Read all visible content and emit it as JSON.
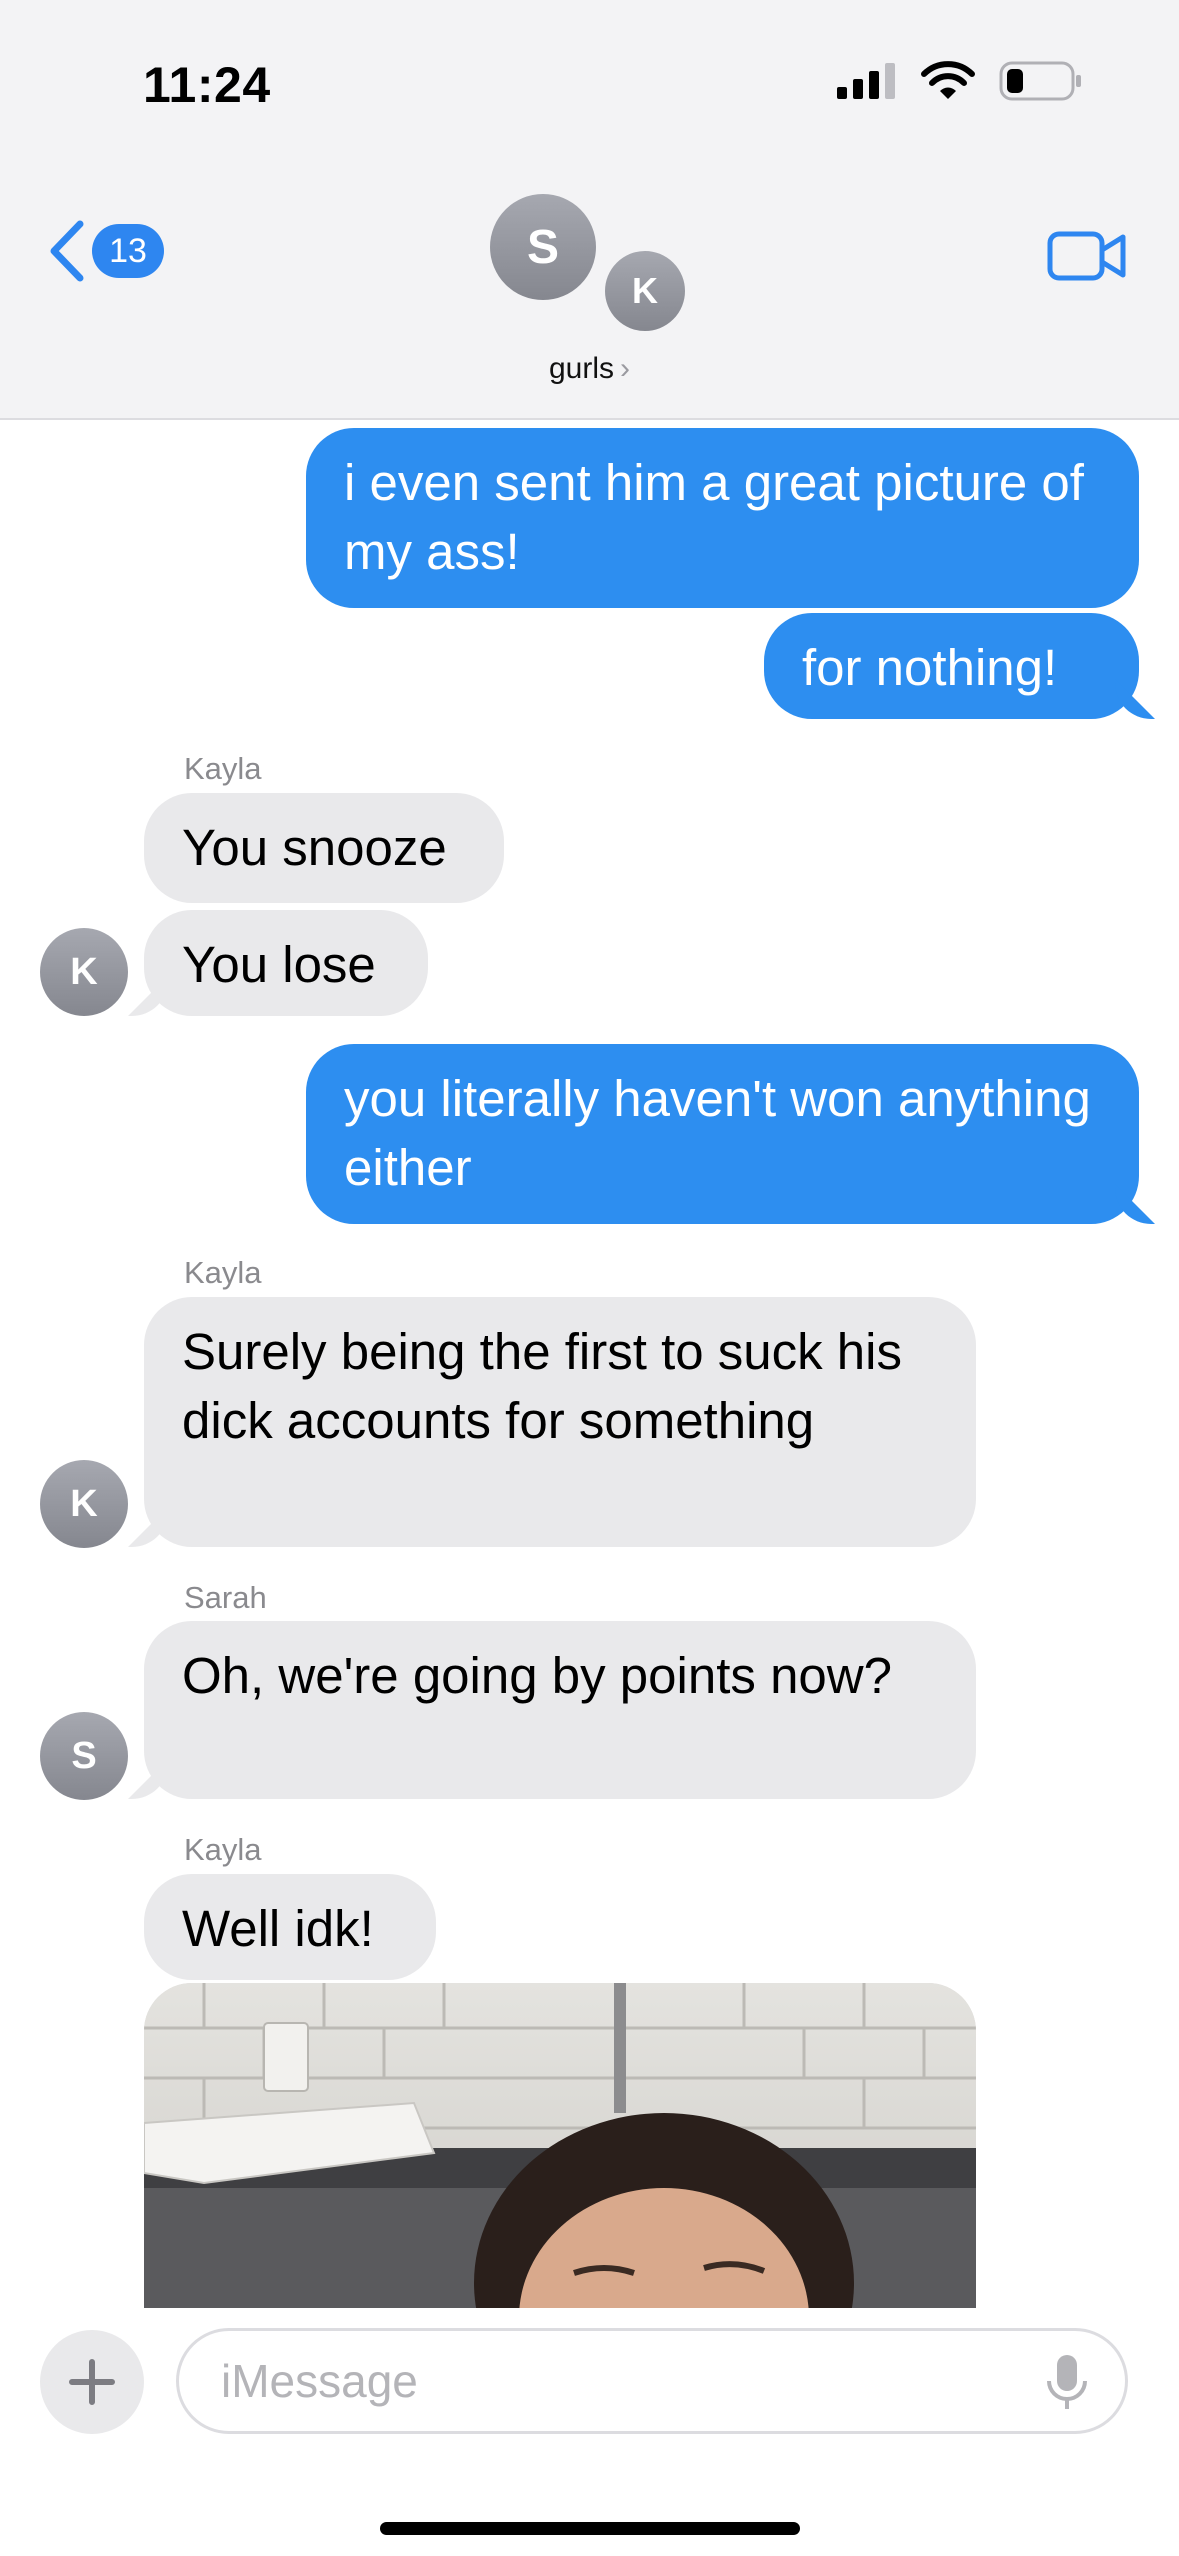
{
  "status_bar": {
    "time": "11:24"
  },
  "header": {
    "back_count": "13",
    "avatar_s": "S",
    "avatar_k": "K",
    "group_name": "gurls",
    "chevron": "›"
  },
  "messages": [
    {
      "from": "me",
      "text": "i even sent him a great picture of my ass!"
    },
    {
      "from": "me",
      "text": "for nothing!"
    },
    {
      "from": "Kayla",
      "sender_label": "Kayla",
      "text": "You snooze"
    },
    {
      "from": "Kayla",
      "text": "You lose",
      "avatar": "K"
    },
    {
      "from": "me",
      "text": "you literally haven't won anything either"
    },
    {
      "from": "Kayla",
      "sender_label": "Kayla",
      "text": "Surely being the first to suck his dick accounts for something",
      "avatar": "K"
    },
    {
      "from": "Sarah",
      "sender_label": "Sarah",
      "text": "Oh, we're going by points now?",
      "avatar": "S"
    },
    {
      "from": "Kayla",
      "sender_label": "Kayla",
      "text": "Well idk!"
    }
  ],
  "input": {
    "placeholder": "iMessage"
  },
  "icons": {
    "back": "chevron-left-icon",
    "video": "video-camera-icon",
    "plus": "plus-icon",
    "mic": "microphone-icon",
    "signal": "cellular-signal-icon",
    "wifi": "wifi-icon",
    "battery": "battery-icon"
  },
  "colors": {
    "accent": "#2e86f0",
    "sent_bubble": "#2d8ef0",
    "received_bubble": "#e9e9eb"
  }
}
